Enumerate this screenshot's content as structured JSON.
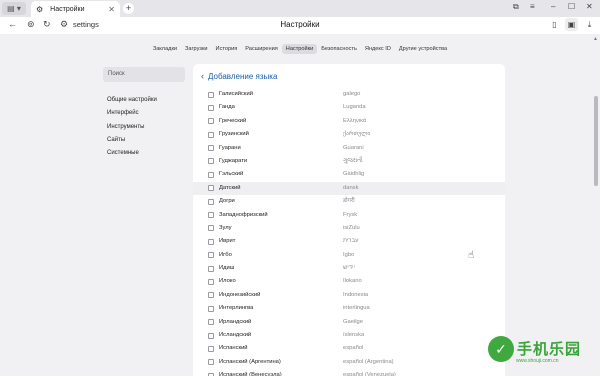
{
  "tabs": {
    "tab_title": "Настройки",
    "icons": {
      "tab_side": "tab-list-icon",
      "tab": "gear-icon",
      "close": "close-icon",
      "new_tab": "plus-icon"
    }
  },
  "toolbar": {
    "address": "settings",
    "page_title": "Настройки"
  },
  "settings_nav": {
    "items": [
      {
        "label": "Закладки",
        "active": false
      },
      {
        "label": "Загрузки",
        "active": false
      },
      {
        "label": "История",
        "active": false
      },
      {
        "label": "Расширения",
        "active": false
      },
      {
        "label": "Настройки",
        "active": true
      },
      {
        "label": "Безопасность",
        "active": false
      },
      {
        "label": "Яндекс ID",
        "active": false
      },
      {
        "label": "Другие устройства",
        "active": false
      }
    ]
  },
  "sidebar": {
    "search_label": "Поиск",
    "items": [
      {
        "label": "Общие настройки"
      },
      {
        "label": "Интерфейс"
      },
      {
        "label": "Инструменты"
      },
      {
        "label": "Сайты"
      },
      {
        "label": "Системные"
      }
    ]
  },
  "panel": {
    "title": "Добавление языка",
    "languages": [
      {
        "name": "Галисийский",
        "native": "galego"
      },
      {
        "name": "Ганда",
        "native": "Luganda"
      },
      {
        "name": "Греческий",
        "native": "Ελληνικά"
      },
      {
        "name": "Грузинский",
        "native": "ქართული"
      },
      {
        "name": "Гуарани",
        "native": "Guarani"
      },
      {
        "name": "Гуджарати",
        "native": "ગુજરાતી"
      },
      {
        "name": "Гэльский",
        "native": "Gàidhlig"
      },
      {
        "name": "Датский",
        "native": "dansk"
      },
      {
        "name": "Догри",
        "native": "डोगरी"
      },
      {
        "name": "Западнофризский",
        "native": "Frysk"
      },
      {
        "name": "Зулу",
        "native": "isiZulu"
      },
      {
        "name": "Иврит",
        "native": "עברית"
      },
      {
        "name": "Игбо",
        "native": "Igbo"
      },
      {
        "name": "Идиш",
        "native": "ייִדיש"
      },
      {
        "name": "Илоко",
        "native": "Ilokano"
      },
      {
        "name": "Индонезийский",
        "native": "Indonesia"
      },
      {
        "name": "Интерлингва",
        "native": "interlingua"
      },
      {
        "name": "Ирландский",
        "native": "Gaeilge"
      },
      {
        "name": "Исландский",
        "native": "íslenska"
      },
      {
        "name": "Испанский",
        "native": "español"
      },
      {
        "name": "Испанский (Аргентина)",
        "native": "español (Argentina)"
      },
      {
        "name": "Испанский (Венесуэла)",
        "native": "español (Venezuela)"
      }
    ],
    "hover_index": 7
  },
  "watermark": {
    "text": "手机乐园",
    "sub": "www.shouji.com.cn"
  },
  "colors": {
    "accent": "#1d5ea8",
    "watermark": "#3aa33a"
  }
}
